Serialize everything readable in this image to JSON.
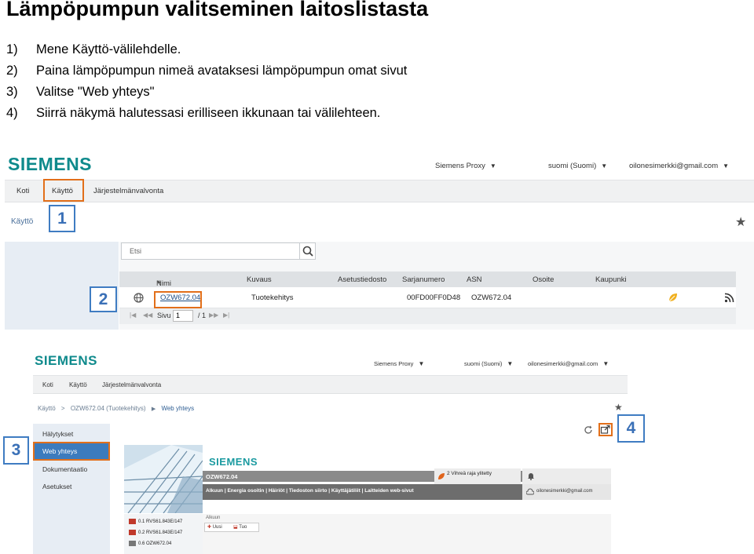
{
  "slide": {
    "title": "Lämpöpumpun valitseminen laitoslistasta",
    "steps": [
      {
        "num": "1)",
        "text": "Mene Käyttö-välilehdelle."
      },
      {
        "num": "2)",
        "text": "Paina lämpöpumpun nimeä avataksesi lämpöpumpun omat sivut"
      },
      {
        "num": "3)",
        "text": "Valitse \"Web yhteys\""
      },
      {
        "num": "4)",
        "text": "Siirrä näkymä halutessasi erilliseen ikkunaan tai välilehteen."
      }
    ]
  },
  "shot1": {
    "logo": "SIEMENS",
    "top": {
      "proxy": "Siemens Proxy",
      "language": "suomi (Suomi)",
      "email": "oilonesimerkki@gmail.com",
      "caret": "▼"
    },
    "tabs": [
      "Koti",
      "Käyttö",
      "Järjestelmänvalvonta"
    ],
    "page_title": "Käyttö",
    "star": "★",
    "search_placeholder": "Etsi",
    "columns": [
      "Nimi",
      "Kuvaus",
      "Asetustiedosto",
      "Sarjanumero",
      "ASN",
      "Osoite",
      "Kaupunki"
    ],
    "sort_arrow": "▲",
    "row": {
      "name": "OZW672.04",
      "description": "Tuotekehitys",
      "asetus": "",
      "serial": "00FD00FF0D48",
      "asn": "OZW672.04",
      "osoite": "",
      "kaupunki": ""
    },
    "pager": {
      "label": "Sivu",
      "page": "1",
      "of": "/ 1"
    },
    "callout1": "1",
    "callout2": "2"
  },
  "shot2": {
    "logo": "SIEMENS",
    "top": {
      "proxy": "Siemens Proxy",
      "language": "suomi (Suomi)",
      "email": "oilonesimerkki@gmail.com",
      "caret": "▼"
    },
    "tabs": [
      "Koti",
      "Käyttö",
      "Järjestelmänvalvonta"
    ],
    "breadcrumb": {
      "a": "Käyttö",
      "sep1": ">",
      "b": "OZW672.04 (Tuotekehitys)",
      "sep2": "▶",
      "c": "Web yhteys"
    },
    "star": "★",
    "sidebar": [
      "Hälytykset",
      "Web yhteys",
      "Dokumentaatio",
      "Asetukset"
    ],
    "callout3": "3",
    "callout4": "4",
    "embed": {
      "logo": "SIEMENS",
      "device": "OZW672.04",
      "alarm": "2 Vihreä raja ylitetty",
      "menu": "Alkuun | Energia osoitin | Häiriöt | Tiedoston siirto | Käyttäjätiliit | Laitteiden web-sivut",
      "email": "oilonesimerkki@gmail.com",
      "crumb": "Alkuun",
      "new": "Uusi",
      "import": "Tuo",
      "devices": [
        "0.1 RVS61.843E/147",
        "0.2 RVS61.843E/147",
        "0.6 OZW672.04"
      ]
    }
  }
}
